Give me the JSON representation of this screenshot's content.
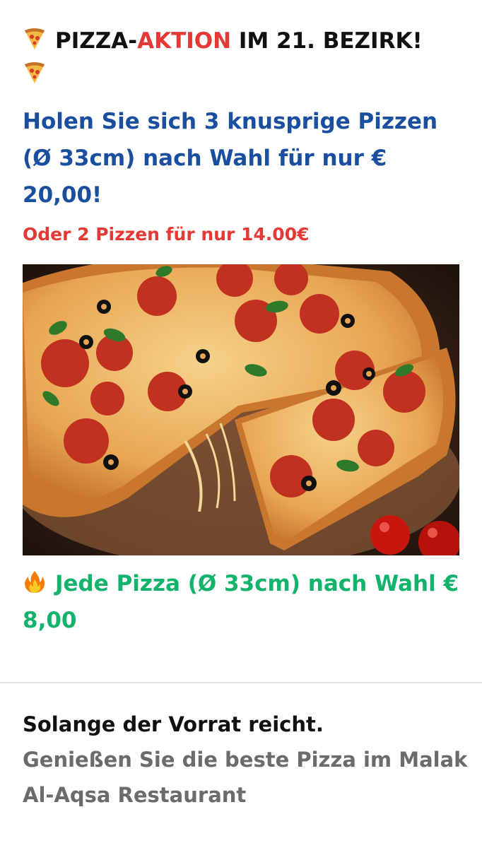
{
  "header": {
    "headline_prefix": "PIZZA-",
    "headline_accent": "AKTION",
    "headline_suffix": " IM 21. BEZIRK!",
    "icon": "pizza-slice-emoji"
  },
  "offer": {
    "main": "Holen Sie sich 3 knusprige Pizzen (Ø 33cm) nach Wahl für nur € 20,00!",
    "alternative": "Oder 2 Pizzen für nur 14.00€"
  },
  "image": {
    "subject": "pepperoni-olive-pizza-photo"
  },
  "price": {
    "icon": "fire-emoji",
    "label": "Jede Pizza (Ø 33cm) nach Wahl € 8,00"
  },
  "footer": {
    "title": "Solange der Vorrat reicht.",
    "text": "Genießen Sie die beste Pizza im Malak Al-Aqsa Restaurant"
  },
  "colors": {
    "accent_red": "#e53935",
    "offer_blue": "#1a4fa0",
    "price_green": "#13b36b",
    "muted_gray": "#6b6b6b"
  }
}
